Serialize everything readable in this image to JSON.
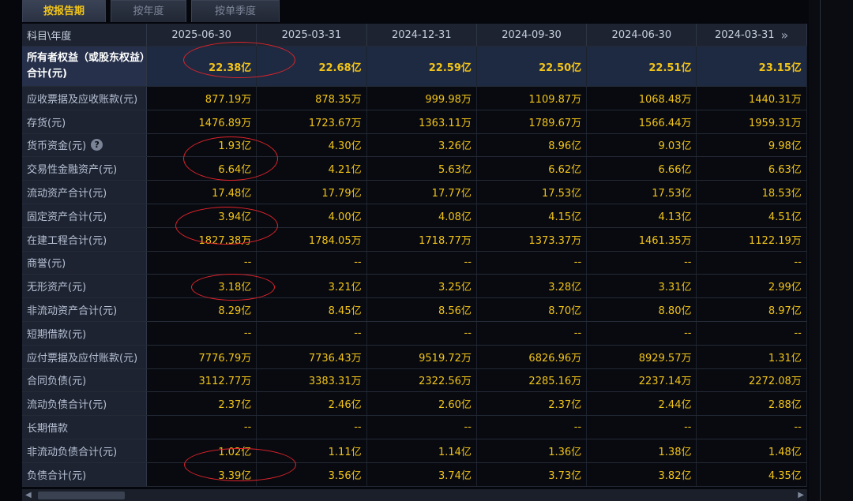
{
  "tabs": [
    {
      "label": "按报告期",
      "active": true
    },
    {
      "label": "按年度",
      "active": false
    },
    {
      "label": "按单季度",
      "active": false
    }
  ],
  "table": {
    "header_label": "科目\\年度",
    "columns": [
      "2025-06-30",
      "2025-03-31",
      "2024-12-31",
      "2024-09-30",
      "2024-06-30",
      "2024-03-31"
    ],
    "nav_icon": "double-chevron-right-icon",
    "rows": [
      {
        "label": "所有者权益（或股东权益）合计(元)",
        "values": [
          "22.38亿",
          "22.68亿",
          "22.59亿",
          "22.50亿",
          "22.51亿",
          "23.15亿"
        ]
      },
      {
        "label": "应收票据及应收账款(元)",
        "values": [
          "877.19万",
          "878.35万",
          "999.98万",
          "1109.87万",
          "1068.48万",
          "1440.31万"
        ]
      },
      {
        "label": "存货(元)",
        "values": [
          "1476.89万",
          "1723.67万",
          "1363.11万",
          "1789.67万",
          "1566.44万",
          "1959.31万"
        ]
      },
      {
        "label": "货币资金(元)",
        "values": [
          "1.93亿",
          "4.30亿",
          "3.26亿",
          "8.96亿",
          "9.03亿",
          "9.98亿"
        ],
        "help": "?"
      },
      {
        "label": "交易性金融资产(元)",
        "values": [
          "6.64亿",
          "4.21亿",
          "5.63亿",
          "6.62亿",
          "6.66亿",
          "6.63亿"
        ]
      },
      {
        "label": "流动资产合计(元)",
        "values": [
          "17.48亿",
          "17.79亿",
          "17.77亿",
          "17.53亿",
          "17.53亿",
          "18.53亿"
        ]
      },
      {
        "label": "固定资产合计(元)",
        "values": [
          "3.94亿",
          "4.00亿",
          "4.08亿",
          "4.15亿",
          "4.13亿",
          "4.51亿"
        ]
      },
      {
        "label": "在建工程合计(元)",
        "values": [
          "1827.38万",
          "1784.05万",
          "1718.77万",
          "1373.37万",
          "1461.35万",
          "1122.19万"
        ]
      },
      {
        "label": "商誉(元)",
        "values": [
          "--",
          "--",
          "--",
          "--",
          "--",
          "--"
        ]
      },
      {
        "label": "无形资产(元)",
        "values": [
          "3.18亿",
          "3.21亿",
          "3.25亿",
          "3.28亿",
          "3.31亿",
          "2.99亿"
        ]
      },
      {
        "label": "非流动资产合计(元)",
        "values": [
          "8.29亿",
          "8.45亿",
          "8.56亿",
          "8.70亿",
          "8.80亿",
          "8.97亿"
        ]
      },
      {
        "label": "短期借款(元)",
        "values": [
          "--",
          "--",
          "--",
          "--",
          "--",
          "--"
        ]
      },
      {
        "label": "应付票据及应付账款(元)",
        "values": [
          "7776.79万",
          "7736.43万",
          "9519.72万",
          "6826.96万",
          "8929.57万",
          "1.31亿"
        ]
      },
      {
        "label": "合同负债(元)",
        "values": [
          "3112.77万",
          "3383.31万",
          "2322.56万",
          "2285.16万",
          "2237.14万",
          "2272.08万"
        ]
      },
      {
        "label": "流动负债合计(元)",
        "values": [
          "2.37亿",
          "2.46亿",
          "2.60亿",
          "2.37亿",
          "2.44亿",
          "2.88亿"
        ]
      },
      {
        "label": "长期借款",
        "values": [
          "--",
          "--",
          "--",
          "--",
          "--",
          "--"
        ]
      },
      {
        "label": "非流动负债合计(元)",
        "values": [
          "1.02亿",
          "1.11亿",
          "1.14亿",
          "1.36亿",
          "1.38亿",
          "1.48亿"
        ]
      },
      {
        "label": "负债合计(元)",
        "values": [
          "3.39亿",
          "3.56亿",
          "3.74亿",
          "3.73亿",
          "3.82亿",
          "4.35亿"
        ]
      }
    ]
  },
  "annotation_color": "#e0232a"
}
